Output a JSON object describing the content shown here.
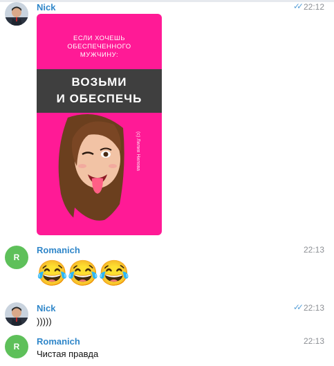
{
  "messages": [
    {
      "sender": "Nick",
      "time": "22:12",
      "read_ticks": "✓✓",
      "avatar": "photo",
      "sticker": {
        "line1": "ЕСЛИ ХОЧЕШЬ",
        "line2": "ОБЕСПЕЧЕННОГО",
        "line3": "МУЖЧИНУ:",
        "big1": "ВОЗЬМИ",
        "big2": "И ОБЕСПЕЧЬ",
        "copyright": "(с) Лилия Нилова",
        "bg_color": "#ff1a96"
      }
    },
    {
      "sender": "Romanich",
      "time": "22:13",
      "avatar_letter": "R",
      "emojis": "😂😂😂"
    },
    {
      "sender": "Nick",
      "time": "22:13",
      "read_ticks": "✓✓",
      "avatar": "photo",
      "text": ")))))"
    },
    {
      "sender": "Romanich",
      "time": "22:13",
      "avatar_letter": "R",
      "text": "Чистая правда"
    }
  ],
  "colors": {
    "sender": "#2f86c9",
    "time": "#8c8f94",
    "ticks": "#5aa1d8",
    "avatar_green": "#5ec05a"
  }
}
